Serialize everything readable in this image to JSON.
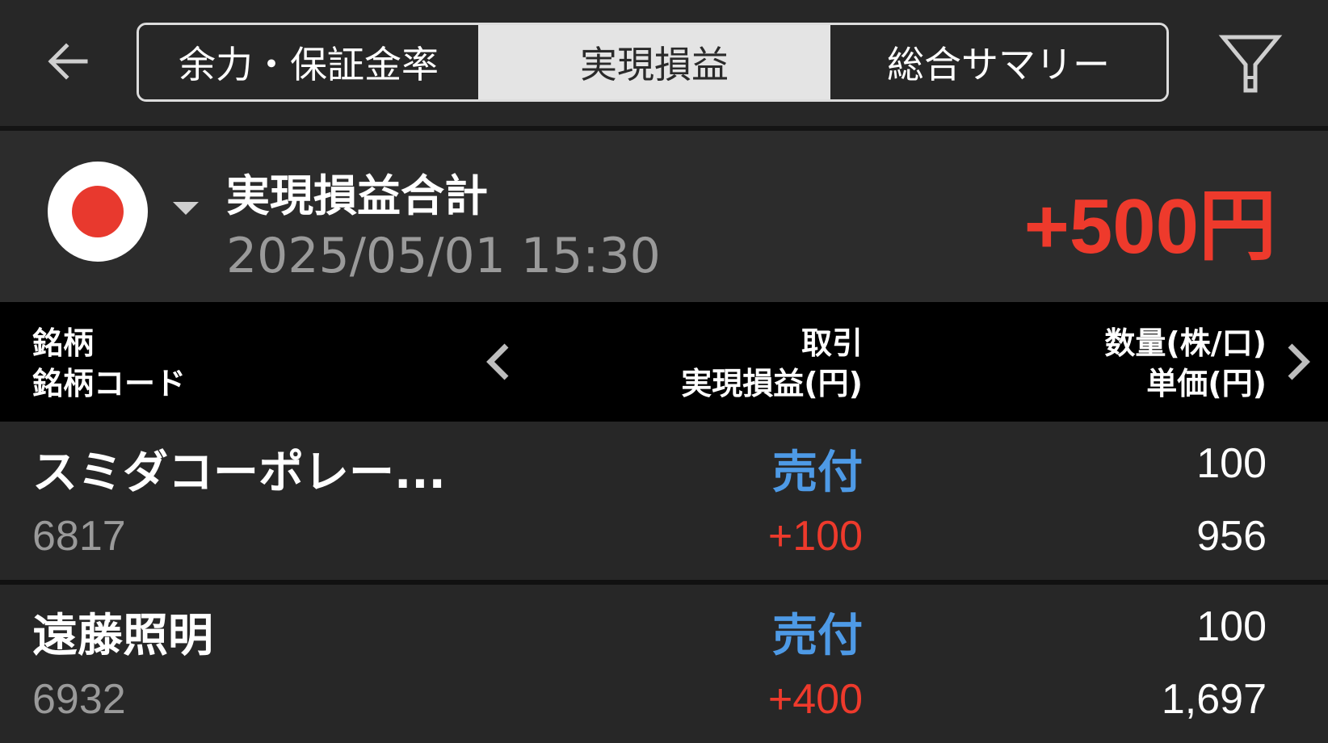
{
  "header": {
    "tabs": [
      {
        "label": "余力・保証金率",
        "active": false
      },
      {
        "label": "実現損益",
        "active": true
      },
      {
        "label": "総合サマリー",
        "active": false
      }
    ],
    "back_icon": "arrow-left-icon",
    "filter_icon": "filter-icon"
  },
  "summary": {
    "market_icon": "japan-flag-icon",
    "title": "実現損益合計",
    "datetime": "2025/05/01  15:30",
    "total": "+500円"
  },
  "table": {
    "col1_line1": "銘柄",
    "col1_line2": "銘柄コード",
    "col2_line1": "取引",
    "col2_line2": "実現損益(円)",
    "col3_line1": "数量(株/口)",
    "col3_line2": "単価(円)",
    "rows": [
      {
        "name": "スミダコーポレー...",
        "code": "6817",
        "trade": "売付",
        "pnl": "+100",
        "qty": "100",
        "price": "956"
      },
      {
        "name": "遠藤照明",
        "code": "6932",
        "trade": "売付",
        "pnl": "+400",
        "qty": "100",
        "price": "1,697"
      }
    ]
  },
  "colors": {
    "profit": "#ee3a2c",
    "sell": "#4e9ae6",
    "header_bg": "#000000",
    "row_bg": "#272727"
  }
}
